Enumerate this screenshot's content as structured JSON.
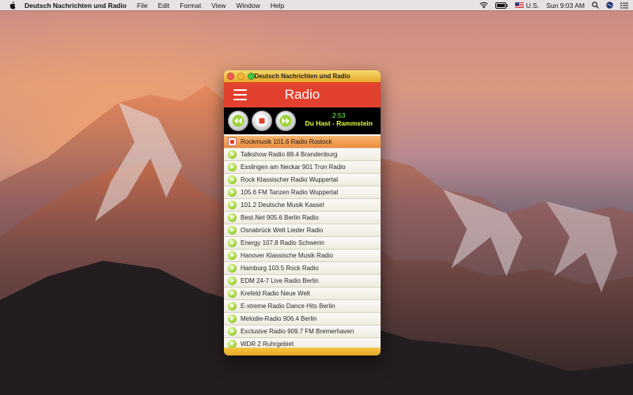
{
  "menubar": {
    "app_name": "Deutsch Nachrichten und Radio",
    "menus": [
      "File",
      "Edit",
      "Format",
      "View",
      "Window",
      "Help"
    ],
    "keyboard_label": "U.S.",
    "clock": "Sun 9:03 AM"
  },
  "window": {
    "title": "Deutsch Nachrichten und Radio",
    "header_title": "Radio"
  },
  "player": {
    "time": "2:53",
    "track": "Du Hast - Rammstein"
  },
  "stations": [
    "Rockmusik 101.6 Radio Rostock",
    "Talkshow Radio 88.4 Brandenburg",
    "Esslingen am Neckar 901 Tron Radio",
    "Rock Klassischer Radio Wuppertal",
    "105.6 FM Tanzen Radio Wuppertal",
    "101.2 Deutsche Musik Kassel",
    "Best.Net 905.6 Berlin Radio",
    "Osnabrück Welt Lieder Radio",
    "Energy 107.8 Radio Schwerin",
    "Hanover Klassische Musik Radio",
    "Hamburg 103.5 Rock Radio",
    "EDM 24-7 Live Radio Berlin",
    "Krefeld Radio Neue Welt",
    "E-xtreme Radio Dance Hits Berlin",
    "Melodie-Radio 906.4 Berlin",
    "Exclusive Radio 909.7 FM Bremerhaven",
    "WDR 2 Ruhrgebiet"
  ],
  "colors": {
    "header": "#e2412d",
    "selected_row": "#ec8d3b",
    "player_text": "#e6ff38"
  }
}
